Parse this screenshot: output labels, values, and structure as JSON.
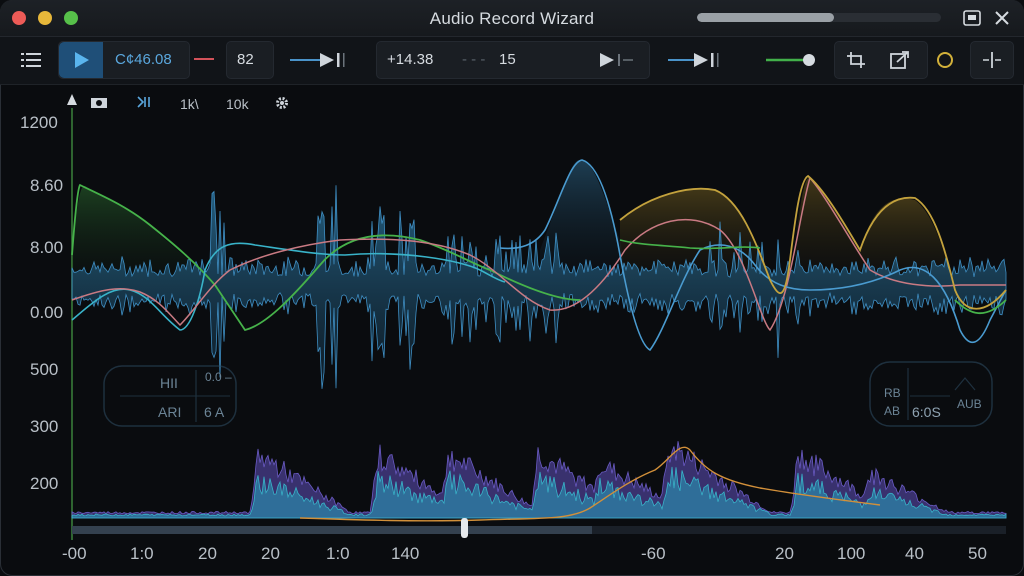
{
  "window": {
    "title": "Audio Record Wizard",
    "progress_fraction": 0.56
  },
  "toolbar": {
    "channel_value": "C¢46.08",
    "gain_value": "82",
    "time_value": "+14.38",
    "step_value": "15"
  },
  "plot_icons": {
    "freq_1": "1k\\",
    "freq_2": "10k"
  },
  "y_axis": {
    "labels": [
      "1200",
      "8.60",
      "8.00",
      "0.00",
      "500",
      "300",
      "200"
    ]
  },
  "x_axis": {
    "labels": [
      "-00",
      "1:0",
      "20",
      "20",
      "1:0",
      "140",
      "-60",
      "20",
      "100",
      "40",
      "50"
    ]
  },
  "overlay_left": {
    "line1": "HII",
    "line2": "ARI",
    "line3": "0.0 –",
    "line4": "6 A"
  },
  "overlay_right": {
    "line1": "RB",
    "line2": "AB",
    "line3": "6:0S",
    "line4": "AUB"
  },
  "colors": {
    "accent_blue": "#3f8fc4",
    "green": "#3fae45",
    "yellow": "#c9a640",
    "pink": "#c7767e",
    "purple": "#6a5bc4",
    "cyan": "#39b3c9"
  }
}
